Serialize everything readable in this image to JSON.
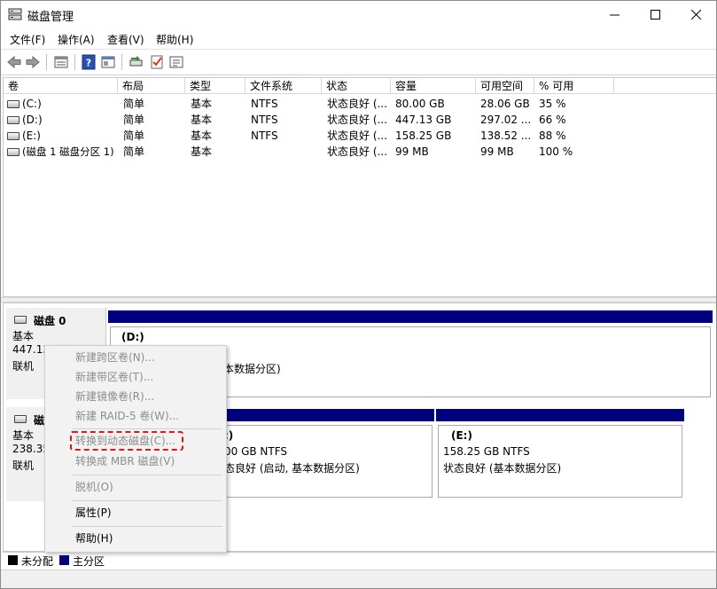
{
  "window": {
    "title": "磁盘管理",
    "controls": {
      "minimize": "—",
      "maximize": "☐",
      "close": "✕"
    }
  },
  "menu": [
    "文件(F)",
    "操作(A)",
    "查看(V)",
    "帮助(H)"
  ],
  "toolbar_icons": [
    "back-icon",
    "forward-icon",
    "list-icon",
    "help-icon",
    "properties-icon",
    "rescan-icon",
    "check-icon",
    "settings-icon"
  ],
  "table": {
    "headers": [
      "卷",
      "布局",
      "类型",
      "文件系统",
      "状态",
      "容量",
      "可用空间",
      "% 可用"
    ],
    "rows": [
      [
        "(C:)",
        "简单",
        "基本",
        "NTFS",
        "状态良好 (...",
        "80.00 GB",
        "28.06 GB",
        "35 %"
      ],
      [
        "(D:)",
        "简单",
        "基本",
        "NTFS",
        "状态良好 (...",
        "447.13 GB",
        "297.02 ...",
        "66 %"
      ],
      [
        "(E:)",
        "简单",
        "基本",
        "NTFS",
        "状态良好 (...",
        "158.25 GB",
        "138.52 ...",
        "88 %"
      ],
      [
        "(磁盘 1 磁盘分区 1)",
        "简单",
        "基本",
        "",
        "状态良好 (...",
        "99 MB",
        "99 MB",
        "100 %"
      ]
    ]
  },
  "disks": [
    {
      "name": "磁盘 0",
      "type": "基本",
      "size": "447.13",
      "status": "联机",
      "partition": {
        "name": "(D:)",
        "detail": "本数据分区)"
      }
    },
    {
      "name": "磁",
      "type": "基本",
      "size": "238.35",
      "status": "联机",
      "partitions": [
        {
          "name": ":)",
          "size": "00 GB NTFS",
          "status": "态良好 (启动, 基本数据分区)"
        },
        {
          "name": "(E:)",
          "size": "158.25 GB NTFS",
          "status": "状态良好 (基本数据分区)"
        }
      ]
    }
  ],
  "legend": [
    "未分配",
    "主分区"
  ],
  "colors": {
    "primary_partition": "#00007f",
    "unallocated": "#000000",
    "highlight": "#e0171c"
  },
  "context_menu": {
    "items": [
      {
        "label": "新建跨区卷(N)...",
        "enabled": false
      },
      {
        "label": "新建带区卷(T)...",
        "enabled": false
      },
      {
        "label": "新建镜像卷(R)...",
        "enabled": false
      },
      {
        "label": "新建 RAID-5 卷(W)...",
        "enabled": false
      },
      {
        "label": "转换到动态磁盘(C)...",
        "enabled": false
      },
      {
        "label": "转换成 MBR 磁盘(V)",
        "enabled": true
      },
      {
        "label": "脱机(O)",
        "enabled": false
      },
      {
        "label": "属性(P)",
        "enabled": true
      },
      {
        "label": "帮助(H)",
        "enabled": true
      }
    ]
  }
}
